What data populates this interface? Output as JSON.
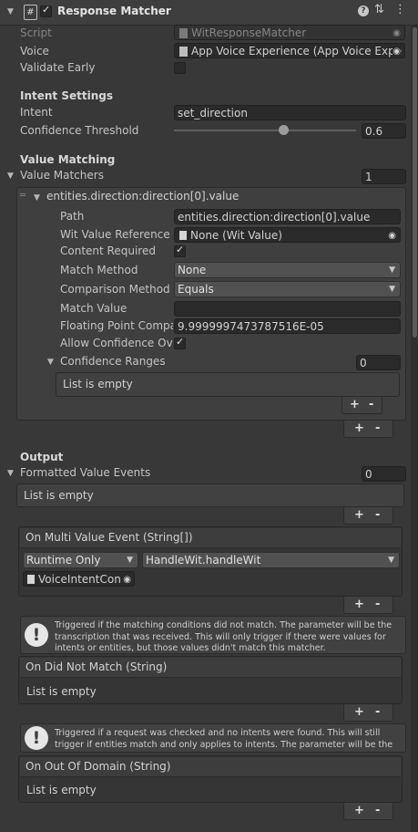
{
  "header": {
    "title": "Response Matcher",
    "script_icon": "#"
  },
  "script_row": {
    "label": "Script",
    "value": "WitResponseMatcher"
  },
  "voice_row": {
    "label": "Voice",
    "value": "App Voice Experience (App Voice Expe"
  },
  "validate_early": {
    "label": "Validate Early",
    "checked": false
  },
  "intent_settings": {
    "title": "Intent Settings",
    "intent_label": "Intent",
    "intent_value": "set_direction",
    "confidence_label": "Confidence Threshold",
    "confidence_value": "0.6",
    "confidence_fraction": 0.6
  },
  "value_matching": {
    "title": "Value Matching",
    "matchers_label": "Value Matchers",
    "matchers_count": "1",
    "element_title": "entities.direction:direction[0].value",
    "path_label": "Path",
    "path_value": "entities.direction:direction[0].value",
    "wit_ref_label": "Wit Value Reference",
    "wit_ref_value": "None (Wit Value)",
    "content_required_label": "Content Required",
    "match_method_label": "Match Method",
    "match_method_value": "None",
    "comparison_label": "Comparison Method",
    "comparison_value": "Equals",
    "match_value_label": "Match Value",
    "match_value_value": "",
    "float_label": "Floating Point Compari",
    "float_value": "9.9999997473787516E-05",
    "allow_conf_label": "Allow Confidence Ove",
    "conf_ranges_label": "Confidence Ranges",
    "conf_ranges_count": "0",
    "list_empty": "List is empty"
  },
  "output": {
    "title": "Output",
    "formatted_label": "Formatted Value Events",
    "formatted_count": "0",
    "list_empty": "List is empty",
    "multi_event_title": "On Multi Value Event (String[])",
    "runtime_value": "Runtime Only",
    "handler_value": "HandleWit.handleWit",
    "object_value": "VoiceIntentCon",
    "help_did_not_match": "Triggered if the matching conditions did not match. The parameter will be the transcription that was received. This will only trigger if there were values for intents or entities, but those values didn't match this matcher.",
    "did_not_match_title": "On Did Not Match (String)",
    "help_out_of_domain": "Triggered if a request was checked and no intents were found. This will still trigger if entities match and only applies to intents. The parameter will be the",
    "out_of_domain_title": "On Out Of Domain (String)"
  },
  "buttons": {
    "plus": "+",
    "minus": "-"
  }
}
